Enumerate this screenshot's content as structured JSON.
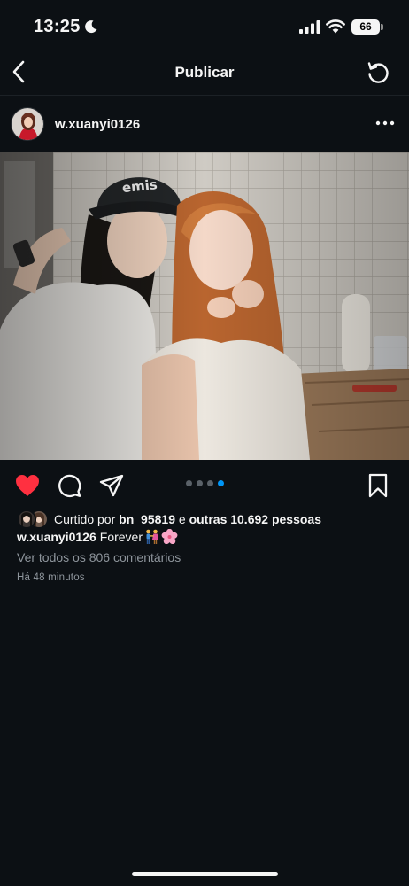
{
  "status_bar": {
    "time": "13:25",
    "battery": "66"
  },
  "header": {
    "title": "Publicar"
  },
  "post": {
    "username": "w.xuanyi0126",
    "carousel": {
      "count": 4,
      "active_index": 3
    },
    "liked": true,
    "likes": {
      "prefix": "Curtido por ",
      "user": "bn_95819",
      "middle": " e ",
      "others": "outras 10.692 pessoas"
    },
    "caption": {
      "username": "w.xuanyi0126",
      "text": "Forever"
    },
    "view_comments": "Ver todos os 806 comentários",
    "timestamp": "Há 48 minutos"
  },
  "icons": {
    "back": "chevron-left-icon",
    "refresh": "refresh-icon",
    "more": "more-horizontal-icon",
    "like": "heart-filled-icon",
    "comment": "comment-icon",
    "share": "paper-plane-icon",
    "save": "bookmark-icon"
  },
  "colors": {
    "background": "#0c1014",
    "like": "#ff3040",
    "carousel_active": "#0095f6",
    "muted_text": "#8e959c"
  }
}
